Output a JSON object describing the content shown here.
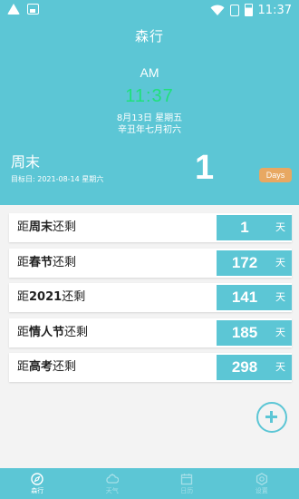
{
  "statusbar": {
    "time": "11:37"
  },
  "app": {
    "title": "森行"
  },
  "clock": {
    "ampm": "AM",
    "time": "11:37",
    "date": "8月13日 星期五",
    "lunar": "辛丑年七月初六",
    "time_color": "#1fe07a"
  },
  "featured": {
    "name": "周末",
    "target": "目标日: 2021-08-14 星期六",
    "days": "1",
    "badge": "Days"
  },
  "events": [
    {
      "prefix": "距",
      "name": "周末",
      "suffix": "还剩",
      "days": "1",
      "unit": "天"
    },
    {
      "prefix": "距",
      "name": "春节",
      "suffix": "还剩",
      "days": "172",
      "unit": "天"
    },
    {
      "prefix": "距",
      "name": "2021",
      "suffix": "还剩",
      "days": "141",
      "unit": "天"
    },
    {
      "prefix": "距",
      "name": "情人节",
      "suffix": "还剩",
      "days": "185",
      "unit": "天"
    },
    {
      "prefix": "距",
      "name": "高考",
      "suffix": "还剩",
      "days": "298",
      "unit": "天"
    }
  ],
  "nav": [
    {
      "label": "森行",
      "icon": "compass-icon",
      "active": true
    },
    {
      "label": "天气",
      "icon": "weather-icon",
      "active": false
    },
    {
      "label": "日历",
      "icon": "calendar-icon",
      "active": false
    },
    {
      "label": "设置",
      "icon": "gear-icon",
      "active": false
    }
  ],
  "colors": {
    "primary": "#5cc6d5",
    "badge": "#e8a862",
    "background": "#f3f3f3"
  }
}
